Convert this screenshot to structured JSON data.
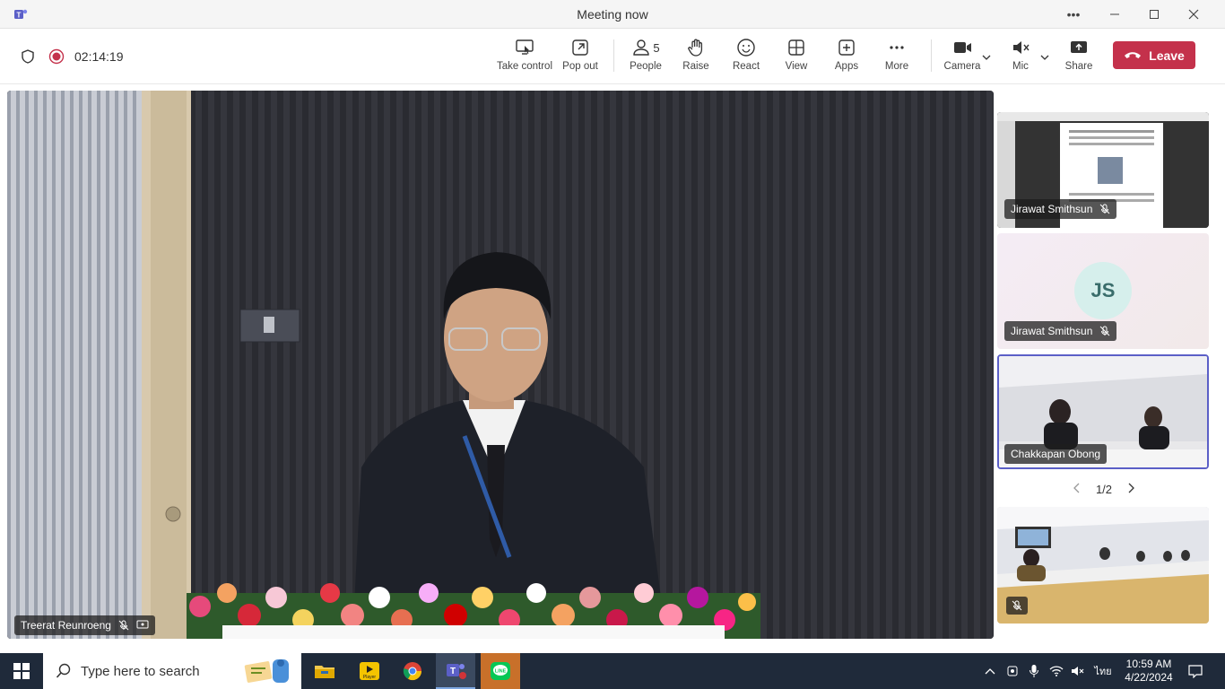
{
  "window": {
    "title": "Meeting now",
    "more_icon": "ellipsis-icon",
    "minimize_icon": "minimize-icon",
    "maximize_icon": "maximize-icon",
    "close_icon": "close-icon"
  },
  "toolbar": {
    "timer": "02:14:19",
    "buttons": [
      {
        "label": "Take control",
        "icon": "take-control-icon"
      },
      {
        "label": "Pop out",
        "icon": "pop-out-icon"
      },
      {
        "label": "People",
        "icon": "people-icon",
        "count": "5"
      },
      {
        "label": "Raise",
        "icon": "hand-icon"
      },
      {
        "label": "React",
        "icon": "smiley-icon"
      },
      {
        "label": "View",
        "icon": "grid-icon"
      },
      {
        "label": "Apps",
        "icon": "plus-square-icon"
      },
      {
        "label": "More",
        "icon": "ellipsis-icon"
      },
      {
        "label": "Camera",
        "icon": "camera-icon"
      },
      {
        "label": "Mic",
        "icon": "mic-off-icon"
      },
      {
        "label": "Share",
        "icon": "share-icon"
      }
    ],
    "leave_label": "Leave"
  },
  "main_video": {
    "participant": "Treerat Reunroeng",
    "muted": true
  },
  "participants": [
    {
      "name": "Jirawat Smithsun",
      "type": "screen-share",
      "muted": true
    },
    {
      "name": "Jirawat Smithsun",
      "type": "avatar",
      "initials": "JS",
      "muted": true
    },
    {
      "name": "Chakkapan Obong",
      "type": "video",
      "active": true
    },
    {
      "name": "",
      "type": "video",
      "muted": true
    }
  ],
  "pager": {
    "text": "1/2"
  },
  "taskbar": {
    "search_placeholder": "Type here to search",
    "apps": [
      "file-explorer-icon",
      "player-icon",
      "chrome-icon",
      "teams-icon",
      "line-icon"
    ],
    "language": "ไทย",
    "time": "10:59 AM",
    "date": "4/22/2024"
  },
  "colors": {
    "leave": "#c4314b",
    "recording": "#c4314b",
    "active_tile_border": "#5b5fc7",
    "taskbar": "#1f2a3a"
  }
}
